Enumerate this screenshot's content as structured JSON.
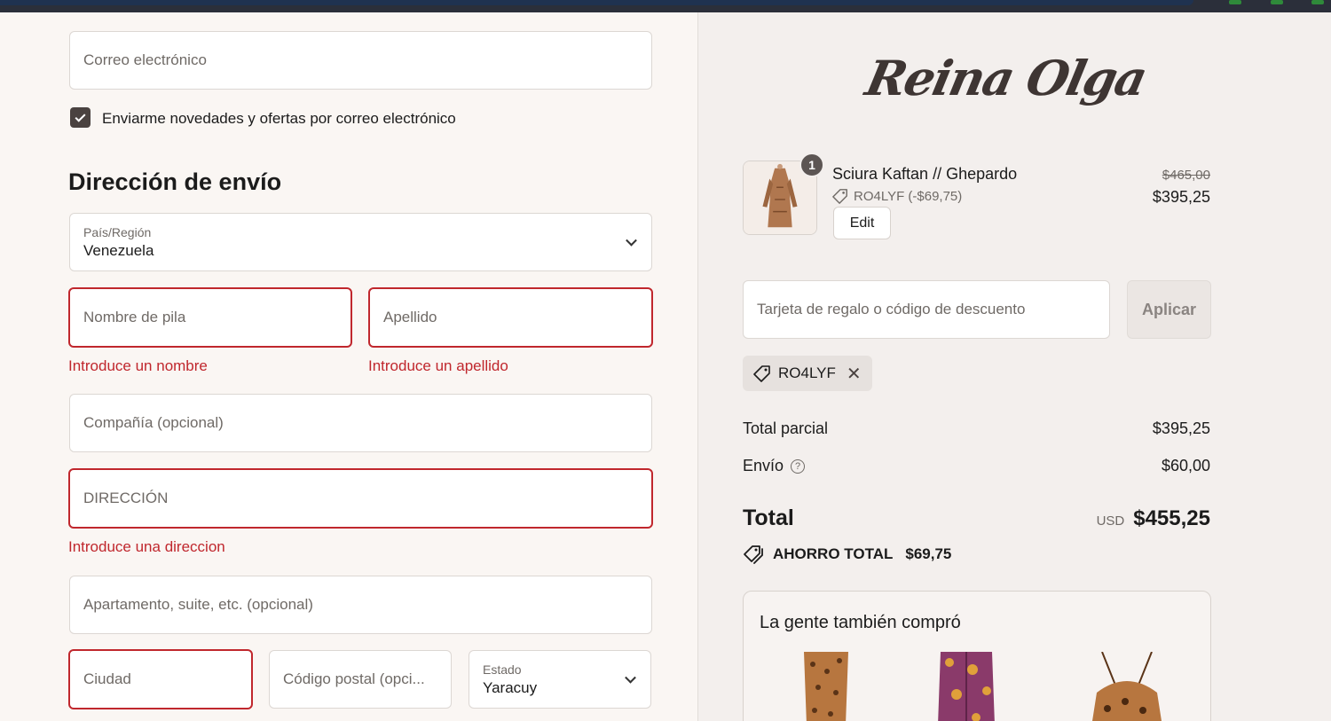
{
  "contact": {
    "email_placeholder": "Correo electrónico",
    "newsletter_label": "Enviarme novedades y ofertas por correo electrónico",
    "newsletter_checked": true
  },
  "shipping": {
    "title": "Dirección de envío",
    "country_label": "País/Región",
    "country_value": "Venezuela",
    "first_name_placeholder": "Nombre de pila",
    "first_name_error": "Introduce un nombre",
    "last_name_placeholder": "Apellido",
    "last_name_error": "Introduce un apellido",
    "company_placeholder": "Compañía (opcional)",
    "address_placeholder": "DIRECCIÓN",
    "address_error": "Introduce una direccion",
    "apartment_placeholder": "Apartamento, suite, etc. (opcional)",
    "city_placeholder": "Ciudad",
    "postal_placeholder": "Código postal (opci...",
    "state_label": "Estado",
    "state_value": "Yaracuy"
  },
  "summary": {
    "logo_text": "Reina Olga",
    "product": {
      "quantity": "1",
      "name": "Sciura Kaftan // Ghepardo",
      "discount_label": "RO4LYF (-$69,75)",
      "edit_label": "Edit",
      "original_price": "$465,00",
      "price": "$395,25"
    },
    "gift_placeholder": "Tarjeta de regalo o código de descuento",
    "apply_label": "Aplicar",
    "applied_code": "RO4LYF",
    "subtotal_label": "Total parcial",
    "subtotal_value": "$395,25",
    "shipping_label": "Envío",
    "shipping_value": "$60,00",
    "total_label": "Total",
    "total_currency": "USD",
    "total_value": "$455,25",
    "savings_label": "AHORRO TOTAL",
    "savings_value": "$69,75",
    "also_bought_title": "La gente también compró"
  },
  "colors": {
    "error": "#c0272d",
    "left_bg": "#faf6f3",
    "right_bg": "#f3efed",
    "checkbox": "#4a4240"
  }
}
